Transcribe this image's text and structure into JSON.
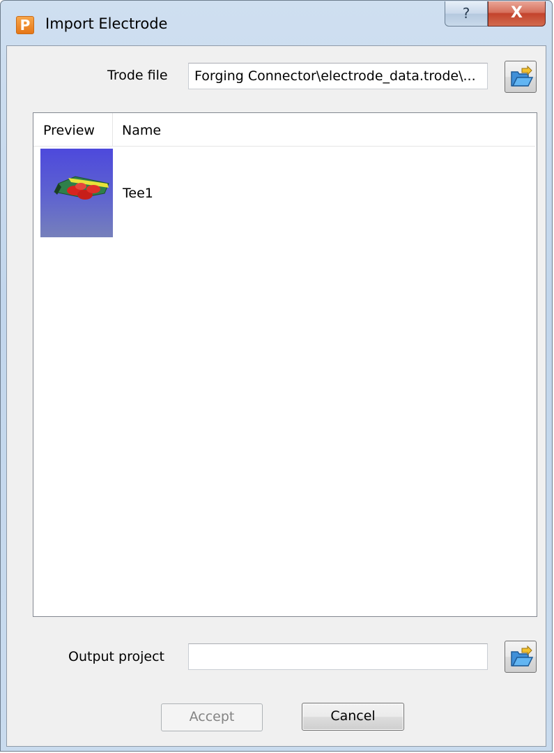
{
  "window": {
    "title": "Import Electrode",
    "app_icon_letter": "P",
    "help_glyph": "?",
    "close_glyph": "X"
  },
  "trode_file": {
    "label": "Trode file",
    "value": "...\\Forging Connector\\electrode_data.trode",
    "browse_icon": "folder-open-icon"
  },
  "electrode_list": {
    "columns": [
      "Preview",
      "Name"
    ],
    "rows": [
      {
        "name": "Tee1",
        "preview": "electrode-thumbnail"
      }
    ]
  },
  "output_project": {
    "label": "Output project",
    "value": "",
    "browse_icon": "folder-open-icon"
  },
  "buttons": {
    "accept": "Accept",
    "cancel": "Cancel"
  },
  "colors": {
    "close_button": "#c3432c",
    "app_icon": "#e67617",
    "preview_background": "#4d49dc"
  }
}
